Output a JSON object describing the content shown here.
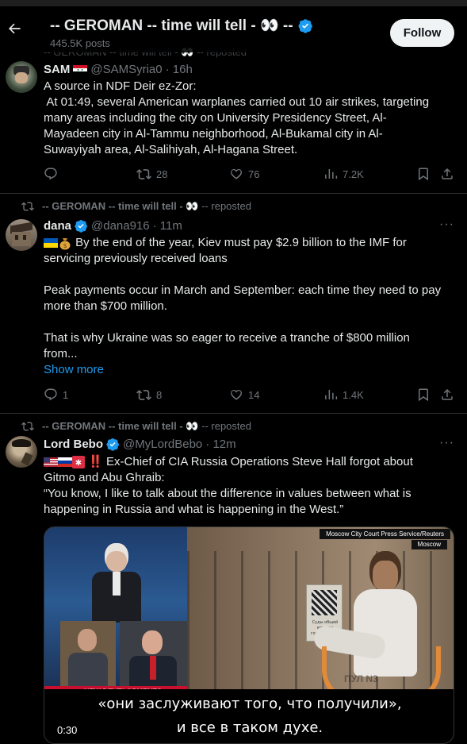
{
  "header": {
    "title": "-- GEROMAN -- time will tell -",
    "title_emoji": "👀",
    "title_tail": "--",
    "subtitle": "445.5K posts",
    "follow_label": "Follow"
  },
  "top_faded": "-- GEROMAN -- time will tell - 👀 -- reposted",
  "tweets": [
    {
      "display_name": "SAM",
      "handle": "@SAMSyria0",
      "time": "· 16h",
      "lines": [
        "A source in NDF Deir ez-Zor:",
        " At 01:49, several American warplanes carried out 10 air strikes, targeting",
        "many areas including the city on University Presidency Street, Al-",
        "Mayadeen city in Al-Tammu neighborhood, Al-Bukamal city in Al-",
        "Suwayiyah area, Al-Salihiyah, Al-Hagana Street."
      ],
      "replies": "",
      "reposts": "28",
      "likes": "76",
      "views": "7.2K"
    },
    {
      "repost_by": "-- GEROMAN -- time will tell -",
      "repost_emoji": "👀",
      "repost_tail": "-- reposted",
      "display_name": "dana",
      "handle": "@dana916",
      "time": "· 11m",
      "lines": [
        "By the end of the year, Kiev must pay $2.9 billion to the IMF for",
        "servicing previously received loans",
        "",
        "Peak payments occur in March and September: each time they need to pay",
        "more than $700 million.",
        "",
        "That is why Ukraine was so eager to receive a tranche of $800 million",
        "from..."
      ],
      "show_more": "Show more",
      "replies": "1",
      "reposts": "8",
      "likes": "14",
      "views": "1.4K"
    },
    {
      "repost_by": "-- GEROMAN -- time will tell -",
      "repost_emoji": "👀",
      "repost_tail": "-- reposted",
      "display_name": "Lord Bebo",
      "handle": "@MyLordBebo",
      "time": "· 12m",
      "lines": [
        "‼️ Ex-Chief of CIA Russia Operations Steve Hall forgot about",
        "Gitmo and Abu Ghraib:",
        "“You know, I like to talk about the difference in values between what is",
        "happening in Russia and what is happening in the West.”"
      ],
      "media": {
        "credit": "Moscow City Court Press Service/Reuters",
        "location": "Moscow",
        "banner": "NEW DEVELOPMENTS",
        "subtitle_1": "«они заслуживают того, что получили»,",
        "subtitle_2": "и все в таком духе.",
        "duration": "0:30",
        "sign_text_1": "Суды общей юрисди",
        "sign_text_2": "города Москв",
        "watermark": "ПУЛ N3"
      }
    }
  ],
  "colors": {
    "accent": "#1d9bf0",
    "muted": "#71767b",
    "divider": "#2f3336",
    "text": "#e7e9ea"
  }
}
